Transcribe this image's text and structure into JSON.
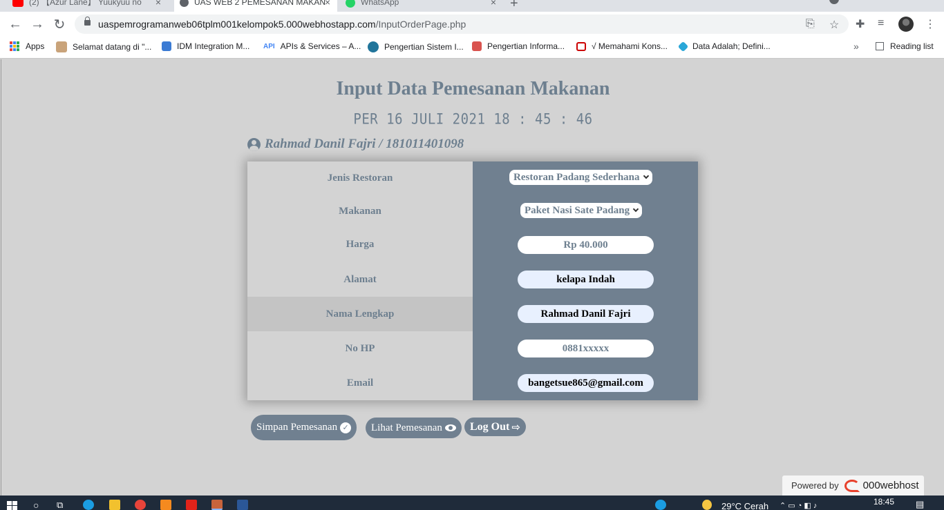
{
  "browser": {
    "tabs": [
      {
        "label": "(2) 【Azur Lane】 Yuukyuu no",
        "active": false
      },
      {
        "label": "UAS WEB 2 PEMESANAN MAKAN",
        "active": true
      },
      {
        "label": "WhatsApp",
        "active": false
      }
    ],
    "url_host": "uaspemrogramanweb06tplm001kelompok5.000webhostapp.com",
    "url_path": "/InputOrderPage.php",
    "bookmarks": [
      "Apps",
      "Selamat datang di \"...",
      "IDM Integration M...",
      "APIs & Services – A...",
      "Pengertian Sistem I...",
      "Pengertian Informa...",
      "√ Memahami Kons...",
      "Data Adalah; Defini..."
    ],
    "reading_list": "Reading list",
    "api_badge": "API"
  },
  "page": {
    "title": "Input Data Pemesanan Makanan",
    "clock": "PER 16 JULI 2021 18 : 45 : 46",
    "user": "Rahmad Danil Fajri / 181011401098",
    "form": {
      "labels": [
        "Jenis Restoran",
        "Makanan",
        "Harga",
        "Alamat",
        "Nama Lengkap",
        "No HP",
        "Email"
      ],
      "restoran": "Restoran Padang Sederhana",
      "makanan": "Paket Nasi Sate Padang",
      "harga": "Rp 40.000",
      "alamat": "kelapa Indah",
      "nama": "Rahmad Danil Fajri",
      "nohp": "0881xxxxx",
      "email": "bangetsue865@gmail.com"
    },
    "buttons": {
      "simpan": "Simpan Pemesanan",
      "lihat": "Lihat Pemesanan",
      "logout": "Log Out"
    },
    "badge": {
      "powered": "Powered by",
      "brand": "000webhost"
    }
  },
  "taskbar": {
    "weather": "29°C  Cerah",
    "time": "18:45"
  },
  "colors": {
    "accent": "#708090",
    "text_muted": "#6d7f8f",
    "page_bg": "#d3d3d3"
  }
}
